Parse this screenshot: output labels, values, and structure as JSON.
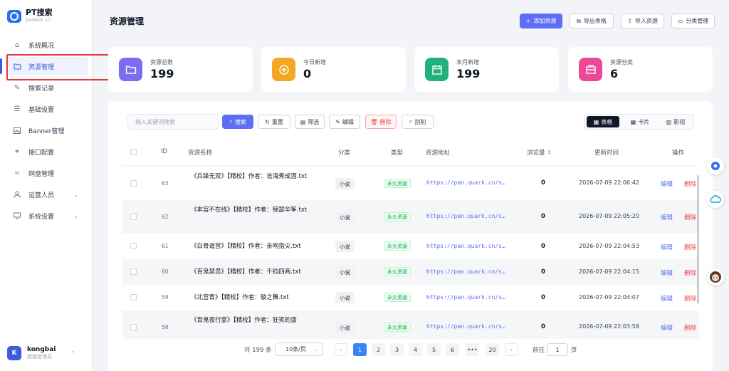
{
  "brand": {
    "name": "PT搜索",
    "domain": "panbot.cn",
    "logo_text": "CBM"
  },
  "sidebar": {
    "items": [
      {
        "label": "系统概况",
        "icon": "home-icon",
        "active": false
      },
      {
        "label": "资源管理",
        "icon": "folder-icon",
        "active": true
      },
      {
        "label": "搜索记录",
        "icon": "pen-icon",
        "active": false
      },
      {
        "label": "基础设置",
        "icon": "sliders-icon",
        "active": false
      },
      {
        "label": "Banner管理",
        "icon": "image-icon",
        "active": false
      },
      {
        "label": "接口配置",
        "icon": "link-icon",
        "active": false
      },
      {
        "label": "网盘管理",
        "icon": "crop-icon",
        "active": false
      },
      {
        "label": "运营人员",
        "icon": "user-icon",
        "active": false,
        "has_children": true
      },
      {
        "label": "系统设置",
        "icon": "monitor-icon",
        "active": false,
        "has_children": true
      }
    ]
  },
  "user": {
    "initial": "K",
    "name": "kongbai",
    "role": "超级管理员"
  },
  "header": {
    "title": "资源管理",
    "buttons": {
      "add": "添加资源",
      "export": "导出表格",
      "import": "导入资源",
      "category": "分类管理"
    }
  },
  "stats": [
    {
      "label": "资源总数",
      "value": "199",
      "color": "#7c6cf2",
      "icon": "folder-icon"
    },
    {
      "label": "今日新增",
      "value": "0",
      "color": "#f5a623",
      "icon": "plus-circle-icon"
    },
    {
      "label": "本月新增",
      "value": "199",
      "color": "#22b07d",
      "icon": "calendar-icon"
    },
    {
      "label": "资源分类",
      "value": "6",
      "color": "#ec4899",
      "icon": "inbox-icon"
    }
  ],
  "toolbar": {
    "search_placeholder": "输入关键词搜索",
    "search": "搜索",
    "reset": "重置",
    "filter": "筛选",
    "edit": "编辑",
    "delete": "删除",
    "scrape": "刮削",
    "views": {
      "table": "表格",
      "card": "卡片",
      "gallery": "影视"
    }
  },
  "table": {
    "headers": {
      "id": "ID",
      "name": "资源名称",
      "category": "分类",
      "type": "类型",
      "url": "资源地址",
      "views": "浏览量",
      "updated": "更新时间",
      "actions": "操作"
    },
    "edit_label": "编辑",
    "delete_label": "删除",
    "rows": [
      {
        "id": "63",
        "name": "《兵锋无双》【精校】作者：沧海煮成酒.txt",
        "category": "小说",
        "type": "永久资源",
        "url": "https://pan.quark.cn/s…",
        "views": "0",
        "updated": "2026-07-09 22:06:42"
      },
      {
        "id": "62",
        "name": "《本宫不在线》【精校】作者：锦瑟华筝.txt",
        "category": "小说",
        "type": "永久资源",
        "url": "https://pan.quark.cn/s…",
        "views": "0",
        "updated": "2026-07-09 22:05:20"
      },
      {
        "id": "61",
        "name": "《白骨道宫》【精校】作者：亲吻指尖.txt",
        "category": "小说",
        "type": "永久资源",
        "url": "https://pan.quark.cn/s…",
        "views": "0",
        "updated": "2026-07-09 22:04:53"
      },
      {
        "id": "60",
        "name": "《百鬼禁忌》【精校】作者：千钧四两.txt",
        "category": "小说",
        "type": "永久资源",
        "url": "https://pan.quark.cn/s…",
        "views": "0",
        "updated": "2026-07-09 22:04:15"
      },
      {
        "id": "59",
        "name": "《北宫青》【精校】作者：璇之舞.txt",
        "category": "小说",
        "type": "永久资源",
        "url": "https://pan.quark.cn/s…",
        "views": "0",
        "updated": "2026-07-09 22:04:07"
      },
      {
        "id": "58",
        "name": "《百鬼夜行宴》【精校】作者：狂笑的菠",
        "category": "小说",
        "type": "永久资源",
        "url": "https://pan.quark.cn/s…",
        "views": "0",
        "updated": "2026-07-09 22:03:58"
      }
    ]
  },
  "pagination": {
    "total": "共 199 条",
    "page_size": "10条/页",
    "pages": [
      "1",
      "2",
      "3",
      "4",
      "5",
      "6",
      "•••",
      "20"
    ],
    "current": "1",
    "goto_label": "前往",
    "goto_value": "1",
    "goto_unit": "页"
  }
}
